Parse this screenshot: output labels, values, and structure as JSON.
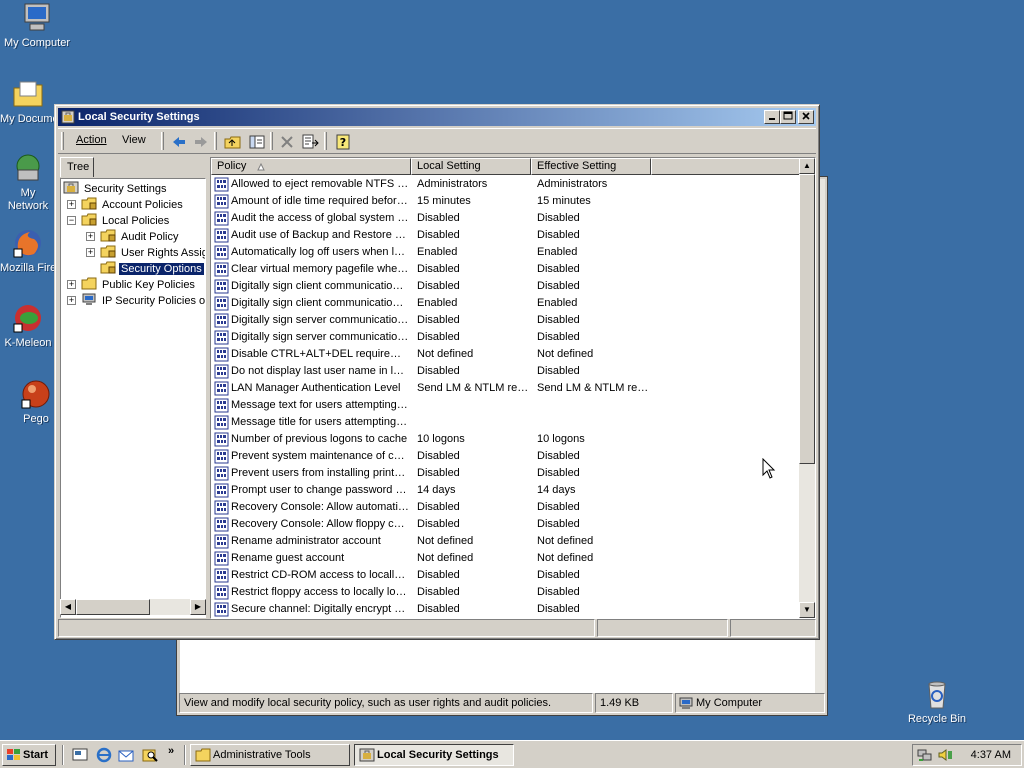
{
  "desktop": {
    "icons": [
      {
        "label": "My Computer"
      },
      {
        "label": "My Documents"
      },
      {
        "label": "My Network Places"
      },
      {
        "label": "Mozilla Firefox"
      },
      {
        "label": "K-Meleon"
      },
      {
        "label": "Pego"
      },
      {
        "label": "Recycle Bin"
      }
    ]
  },
  "bg_window": {
    "status_text": "View and modify local security policy, such as user rights and audit policies.",
    "size": "1.49 KB",
    "location": "My Computer"
  },
  "window": {
    "title": "Local Security Settings",
    "menu": {
      "action": "Action",
      "view": "View"
    },
    "tree_tab": "Tree",
    "tree": [
      {
        "label": "Security Settings"
      },
      {
        "label": "Account Policies"
      },
      {
        "label": "Local Policies"
      },
      {
        "label": "Audit Policy"
      },
      {
        "label": "User Rights Assignment"
      },
      {
        "label": "Security Options"
      },
      {
        "label": "Public Key Policies"
      },
      {
        "label": "IP Security Policies on Local Machine"
      }
    ],
    "columns": {
      "policy": "Policy",
      "local": "Local Setting",
      "effective": "Effective Setting"
    },
    "rows": [
      {
        "policy": "Allowed to eject removable NTFS media",
        "local": "Administrators",
        "effective": "Administrators"
      },
      {
        "policy": "Amount of idle time required before disconnecting session",
        "local": "15 minutes",
        "effective": "15 minutes"
      },
      {
        "policy": "Audit the access of global system objects",
        "local": "Disabled",
        "effective": "Disabled"
      },
      {
        "policy": "Audit use of Backup and Restore privilege",
        "local": "Disabled",
        "effective": "Disabled"
      },
      {
        "policy": "Automatically log off users when logon time expires",
        "local": "Enabled",
        "effective": "Enabled"
      },
      {
        "policy": "Clear virtual memory pagefile when system shuts down",
        "local": "Disabled",
        "effective": "Disabled"
      },
      {
        "policy": "Digitally sign client communication (always)",
        "local": "Disabled",
        "effective": "Disabled"
      },
      {
        "policy": "Digitally sign client communication (when possible)",
        "local": "Enabled",
        "effective": "Enabled"
      },
      {
        "policy": "Digitally sign server communication (always)",
        "local": "Disabled",
        "effective": "Disabled"
      },
      {
        "policy": "Digitally sign server communication (when possible)",
        "local": "Disabled",
        "effective": "Disabled"
      },
      {
        "policy": "Disable CTRL+ALT+DEL requirement for logon",
        "local": "Not defined",
        "effective": "Not defined"
      },
      {
        "policy": "Do not display last user name in logon screen",
        "local": "Disabled",
        "effective": "Disabled"
      },
      {
        "policy": "LAN Manager Authentication Level",
        "local": "Send LM & NTLM responses",
        "effective": "Send LM & NTLM responses"
      },
      {
        "policy": "Message text for users attempting to log on",
        "local": "",
        "effective": ""
      },
      {
        "policy": "Message title for users attempting to log on",
        "local": "",
        "effective": ""
      },
      {
        "policy": "Number of previous logons to cache",
        "local": "10 logons",
        "effective": "10 logons"
      },
      {
        "policy": "Prevent system maintenance of computer account password",
        "local": "Disabled",
        "effective": "Disabled"
      },
      {
        "policy": "Prevent users from installing printer drivers",
        "local": "Disabled",
        "effective": "Disabled"
      },
      {
        "policy": "Prompt user to change password before expiration",
        "local": "14 days",
        "effective": "14 days"
      },
      {
        "policy": "Recovery Console: Allow automatic administrative logon",
        "local": "Disabled",
        "effective": "Disabled"
      },
      {
        "policy": "Recovery Console: Allow floppy copy and access to all drives",
        "local": "Disabled",
        "effective": "Disabled"
      },
      {
        "policy": "Rename administrator account",
        "local": "Not defined",
        "effective": "Not defined"
      },
      {
        "policy": "Rename guest account",
        "local": "Not defined",
        "effective": "Not defined"
      },
      {
        "policy": "Restrict CD-ROM access to locally logged-on user only",
        "local": "Disabled",
        "effective": "Disabled"
      },
      {
        "policy": "Restrict floppy access to locally logged-on user only",
        "local": "Disabled",
        "effective": "Disabled"
      },
      {
        "policy": "Secure channel: Digitally encrypt or sign secure channel data",
        "local": "Disabled",
        "effective": "Disabled"
      }
    ]
  },
  "taskbar": {
    "start": "Start",
    "tasks": [
      {
        "label": "Administrative Tools"
      },
      {
        "label": "Local Security Settings"
      }
    ],
    "clock": "4:37 AM"
  },
  "colors": {
    "desktop": "#3a6ea5",
    "title_active": "#0a246a",
    "face": "#d4d0c8"
  }
}
